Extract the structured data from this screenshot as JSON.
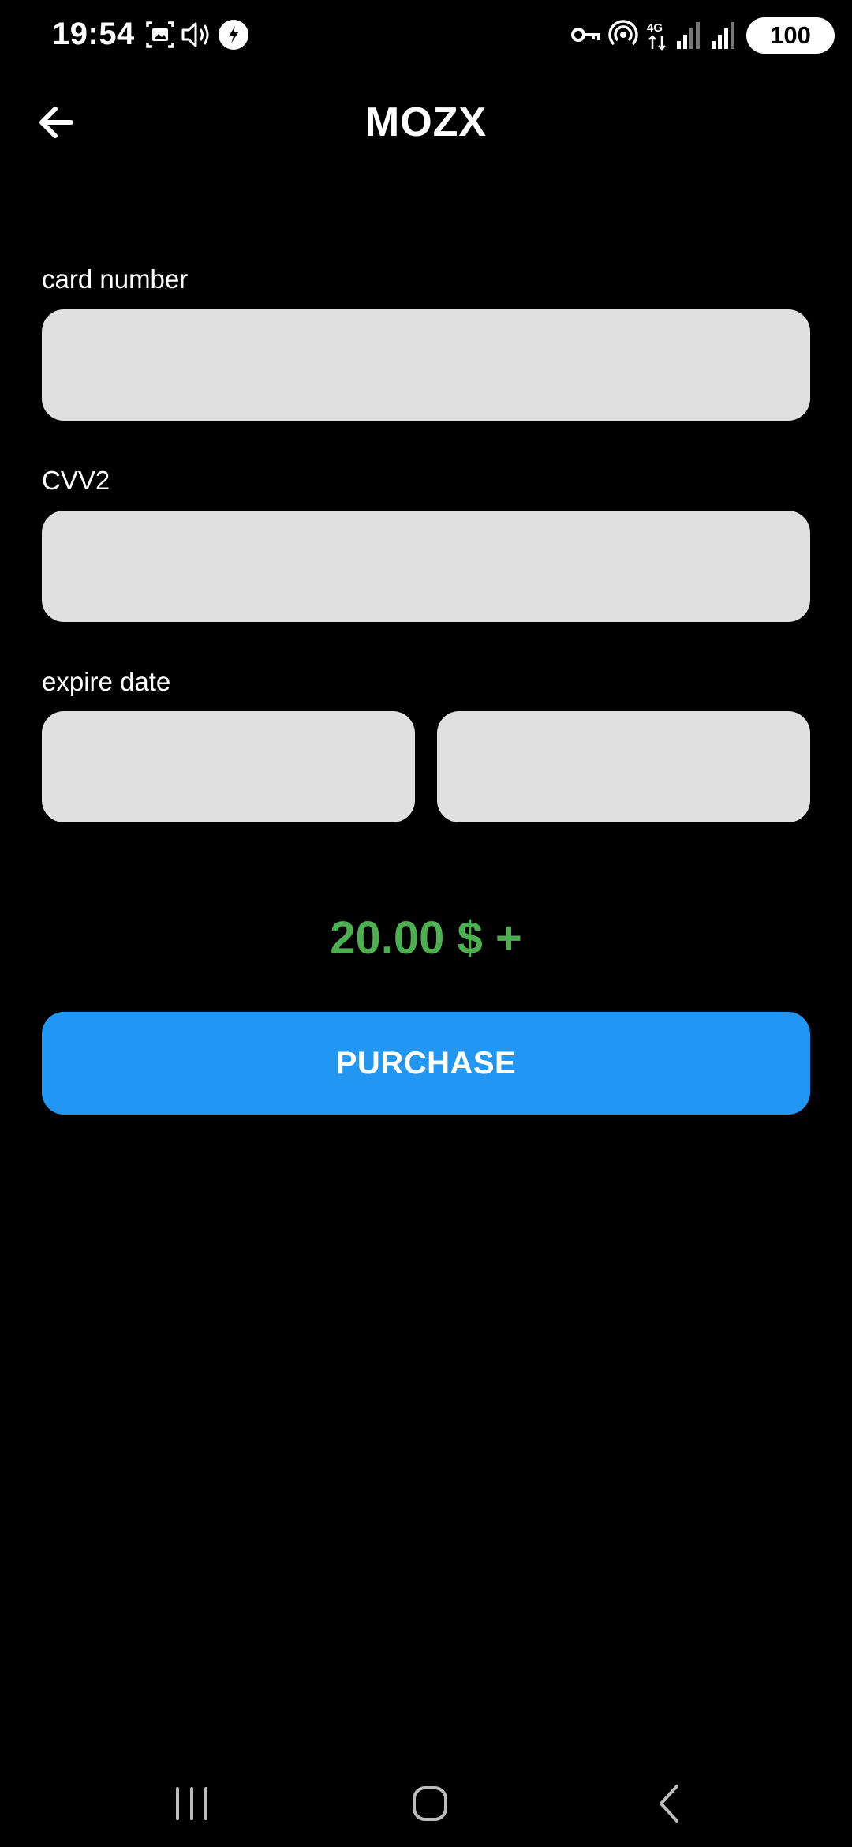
{
  "status_bar": {
    "time": "19:54",
    "battery": "100",
    "icons": [
      "screenshot-icon",
      "volume-icon",
      "flash-app-icon",
      "vpn-key-icon",
      "hotspot-icon",
      "network-4g-icon",
      "signal-1-icon",
      "signal-2-icon"
    ]
  },
  "app_bar": {
    "back_icon": "arrow-back-icon",
    "title": "MOZX"
  },
  "form": {
    "card_number_label": "card number",
    "card_number_value": "",
    "cvv2_label": "CVV2",
    "cvv2_value": "",
    "expire_date_label": "expire date",
    "expire_month_value": "",
    "expire_year_value": ""
  },
  "price": {
    "text": "20.00 $ +",
    "color": "#4caf50"
  },
  "purchase_button": {
    "label": "PURCHASE",
    "color": "#2196f3"
  },
  "nav_bar": {
    "icons": [
      "recent-apps-icon",
      "home-icon",
      "back-icon"
    ]
  }
}
